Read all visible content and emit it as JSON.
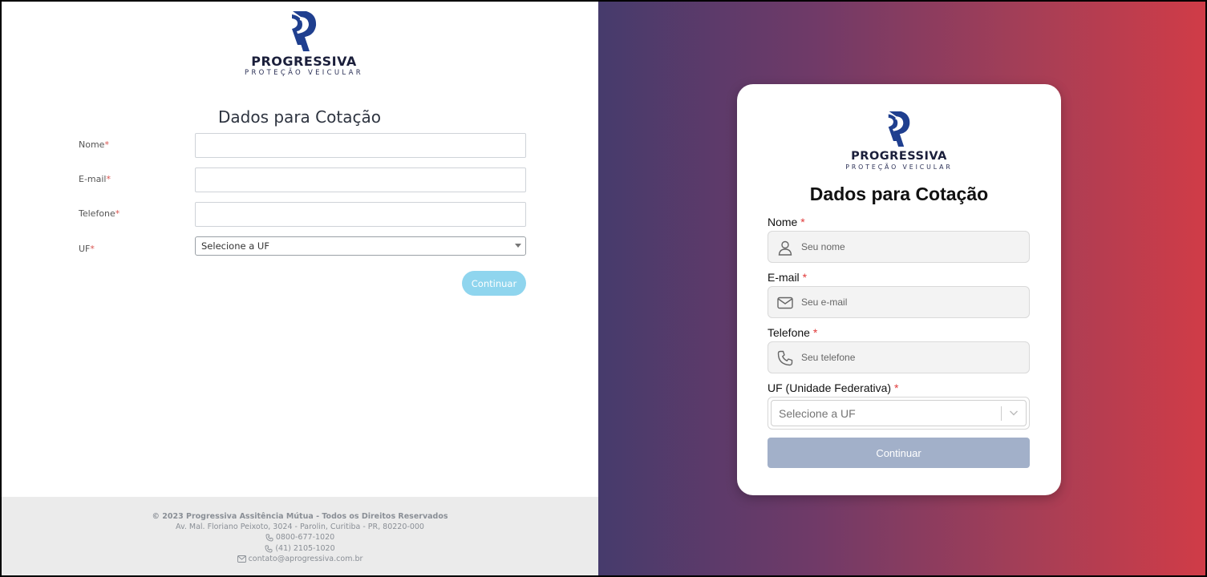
{
  "left": {
    "logo": {
      "brand": "PROGRESSIVA",
      "tagline": "PROTEÇÃO VEICULAR"
    },
    "title": "Dados para Cotação",
    "fields": [
      {
        "label": "Nome",
        "required": "*",
        "value": ""
      },
      {
        "label": "E-mail",
        "required": "*",
        "value": ""
      },
      {
        "label": "Telefone",
        "required": "*",
        "value": ""
      }
    ],
    "uf": {
      "label": "UF",
      "required": "*",
      "selected": "Selecione a UF"
    },
    "continue_label": "Continuar",
    "footer": {
      "copyright": "© 2023 Progressiva Assitência Mútua - Todos os Direitos Reservados",
      "address": "Av. Mal. Floriano Peixoto, 3024 - Parolin, Curitiba - PR, 80220-000",
      "phone1": "0800-677-1020",
      "phone2": "(41) 2105-1020",
      "email": "contato@aprogressiva.com.br"
    }
  },
  "card": {
    "logo": {
      "brand": "PROGRESSIVA",
      "tagline": "PROTEÇÃO VEICULAR"
    },
    "title": "Dados para Cotação",
    "fields": [
      {
        "label": "Nome",
        "required": "*",
        "placeholder": "Seu nome",
        "icon": "user-icon"
      },
      {
        "label": "E-mail",
        "required": "*",
        "placeholder": "Seu e-mail",
        "icon": "mail-icon"
      },
      {
        "label": "Telefone",
        "required": "*",
        "placeholder": "Seu telefone",
        "icon": "phone-icon"
      }
    ],
    "uf": {
      "label": "UF (Unidade Federativa)",
      "required": "*",
      "placeholder": "Selecione a UF"
    },
    "continue_label": "Continuar"
  },
  "colors": {
    "brand_blue": "#1f3f8f",
    "left_button": "#8fd5ee",
    "card_button": "#a2b0c9",
    "gradient_start": "#463b6c",
    "gradient_end": "#d03c47",
    "required": "#e03a3a"
  }
}
